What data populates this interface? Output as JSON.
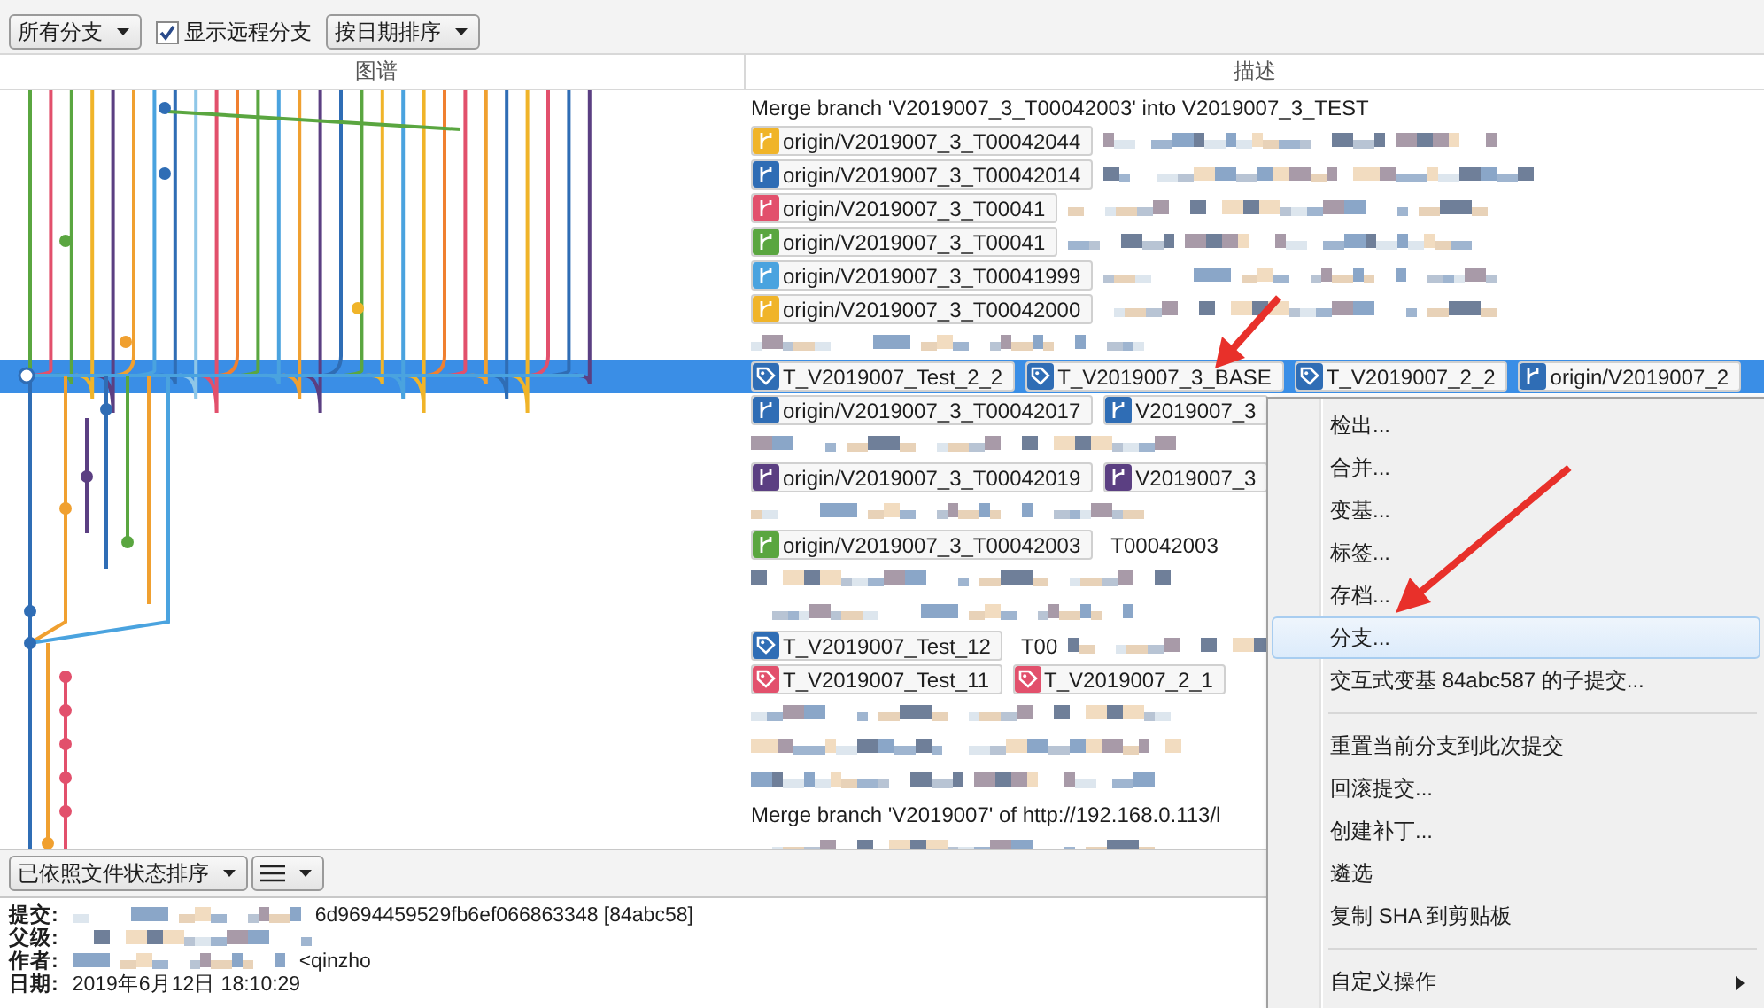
{
  "toolbar": {
    "branch_filter": "所有分支",
    "show_remote": {
      "label": "显示远程分支",
      "checked": true
    },
    "sort": "按日期排序"
  },
  "columns": [
    "图谱",
    "描述"
  ],
  "rows": [
    {
      "kind": "text",
      "text": "Merge branch 'V2019007_3_T00042003' into V2019007_3_TEST",
      "selected": false
    },
    {
      "kind": "refs",
      "selected": false,
      "redacted": true,
      "refs": [
        {
          "kind": "branch",
          "label": "origin/V2019007_3_T00042044",
          "color": "#f0b429"
        }
      ]
    },
    {
      "kind": "refs",
      "selected": false,
      "redacted": true,
      "refs": [
        {
          "kind": "branch",
          "label": "origin/V2019007_3_T00042014",
          "color": "#2f6db5"
        }
      ]
    },
    {
      "kind": "refs",
      "selected": false,
      "redacted": true,
      "refs": [
        {
          "kind": "branch",
          "label": "origin/V2019007_3_T00041",
          "color": "#e2506c"
        }
      ]
    },
    {
      "kind": "refs",
      "selected": false,
      "redacted": true,
      "refs": [
        {
          "kind": "branch",
          "label": "origin/V2019007_3_T00041",
          "color": "#5aa640"
        }
      ]
    },
    {
      "kind": "refs",
      "selected": false,
      "redacted": true,
      "refs": [
        {
          "kind": "branch",
          "label": "origin/V2019007_3_T00041999",
          "color": "#4aa3df"
        }
      ]
    },
    {
      "kind": "refs",
      "selected": false,
      "redacted": true,
      "refs": [
        {
          "kind": "branch",
          "label": "origin/V2019007_3_T00042000",
          "color": "#f0b429"
        }
      ]
    },
    {
      "kind": "redacted",
      "selected": false
    },
    {
      "kind": "refs",
      "selected": true,
      "redacted": false,
      "refs": [
        {
          "kind": "tag",
          "label": "T_V2019007_Test_2_2",
          "color": "#2f6db5"
        },
        {
          "kind": "tag",
          "label": "T_V2019007_3_BASE",
          "color": "#2f6db5"
        },
        {
          "kind": "tag",
          "label": "T_V2019007_2_2",
          "color": "#2f6db5"
        },
        {
          "kind": "branch",
          "label": "origin/V2019007_2",
          "color": "#2f6db5"
        }
      ]
    },
    {
      "kind": "refs",
      "selected": false,
      "redacted": false,
      "refs": [
        {
          "kind": "branch",
          "label": "origin/V2019007_3_T00042017",
          "color": "#2f6db5"
        },
        {
          "kind": "branch",
          "label": "V2019007_3",
          "color": "#2f6db5"
        }
      ]
    },
    {
      "kind": "redacted",
      "selected": false
    },
    {
      "kind": "refs",
      "selected": false,
      "redacted": false,
      "refs": [
        {
          "kind": "branch",
          "label": "origin/V2019007_3_T00042019",
          "color": "#5b3f82"
        },
        {
          "kind": "branch",
          "label": "V2019007_3",
          "color": "#5b3f82"
        }
      ]
    },
    {
      "kind": "redacted",
      "selected": false
    },
    {
      "kind": "refs",
      "selected": false,
      "redacted": false,
      "text": "T00042003",
      "refs": [
        {
          "kind": "branch",
          "label": "origin/V2019007_3_T00042003",
          "color": "#5aa640"
        }
      ]
    },
    {
      "kind": "redacted",
      "selected": false
    },
    {
      "kind": "redacted",
      "selected": false
    },
    {
      "kind": "refs",
      "selected": false,
      "redacted": true,
      "text": "T00",
      "refs": [
        {
          "kind": "tag",
          "label": "T_V2019007_Test_12",
          "color": "#2f6db5"
        }
      ]
    },
    {
      "kind": "refs",
      "selected": false,
      "redacted": false,
      "refs": [
        {
          "kind": "tag",
          "label": "T_V2019007_Test_11",
          "color": "#e2506c"
        },
        {
          "kind": "tag",
          "label": "T_V2019007_2_1",
          "color": "#e2506c"
        }
      ]
    },
    {
      "kind": "redacted",
      "selected": false
    },
    {
      "kind": "redacted",
      "selected": false
    },
    {
      "kind": "redacted",
      "selected": false
    },
    {
      "kind": "text",
      "text": "Merge branch 'V2019007' of http://192.168.0.113/l",
      "selected": false
    },
    {
      "kind": "redacted",
      "selected": false
    }
  ],
  "bottom_toolbar": {
    "sort": "已依照文件状态排序"
  },
  "details": [
    {
      "label": "提交:",
      "redacted": true,
      "value": "6d9694459529fb6ef066863348 [84abc58]"
    },
    {
      "label": "父级:",
      "redacted": true
    },
    {
      "label": "作者:",
      "redacted": true,
      "value": "<qinzho"
    },
    {
      "label": "日期:",
      "redacted": false,
      "value": "2019年6月12日 18:10:29"
    }
  ],
  "context_menu": [
    {
      "kind": "item",
      "label": "检出...",
      "selected": false
    },
    {
      "kind": "item",
      "label": "合并...",
      "selected": false
    },
    {
      "kind": "item",
      "label": "变基...",
      "selected": false
    },
    {
      "kind": "item",
      "label": "标签...",
      "selected": false
    },
    {
      "kind": "item",
      "label": "存档...",
      "selected": false
    },
    {
      "kind": "item",
      "label": "分支...",
      "selected": true
    },
    {
      "kind": "item",
      "label": "交互式变基 84abc587 的子提交...",
      "selected": false
    },
    {
      "kind": "separator"
    },
    {
      "kind": "item",
      "label": "重置当前分支到此次提交",
      "selected": false
    },
    {
      "kind": "item",
      "label": "回滚提交...",
      "selected": false
    },
    {
      "kind": "item",
      "label": "创建补丁...",
      "selected": false
    },
    {
      "kind": "item",
      "label": "遴选",
      "selected": false
    },
    {
      "kind": "item",
      "label": "复制 SHA 到剪贴板",
      "selected": false
    },
    {
      "kind": "separator"
    },
    {
      "kind": "item",
      "label": "自定义操作",
      "selected": false,
      "submenu": true
    }
  ]
}
